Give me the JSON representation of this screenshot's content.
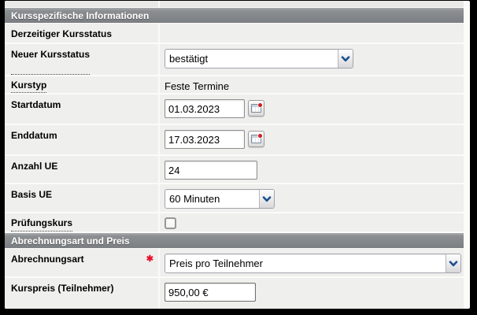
{
  "course_section": {
    "title": "Kursspezifische Informationen",
    "rows": {
      "current_status": {
        "label": "Derzeitiger Kursstatus",
        "value": ""
      },
      "new_status": {
        "label": "Neuer Kursstatus",
        "value": "bestätigt"
      },
      "course_type": {
        "label": "Kurstyp",
        "value": "Feste Termine"
      },
      "start_date": {
        "label": "Startdatum",
        "value": "01.03.2023"
      },
      "end_date": {
        "label": "Enddatum",
        "value": "17.03.2023"
      },
      "units_count": {
        "label": "Anzahl UE",
        "value": "24"
      },
      "unit_basis": {
        "label": "Basis UE",
        "value": "60 Minuten"
      },
      "exam_course": {
        "label": "Prüfungskurs",
        "checked": false
      }
    }
  },
  "billing_section": {
    "title": "Abrechnungsart und Preis",
    "rows": {
      "billing_type": {
        "label": "Abrechnungsart",
        "required_marker": "✱",
        "value": "Preis pro Teilnehmer"
      },
      "course_price": {
        "label": "Kurspreis (Teilnehmer)",
        "value": "950,00 €"
      }
    }
  },
  "colors": {
    "header_bg": "#85888b",
    "row_bg": "#efefee",
    "accent_blue": "#1d4f91",
    "required_red": "#e8112d"
  }
}
